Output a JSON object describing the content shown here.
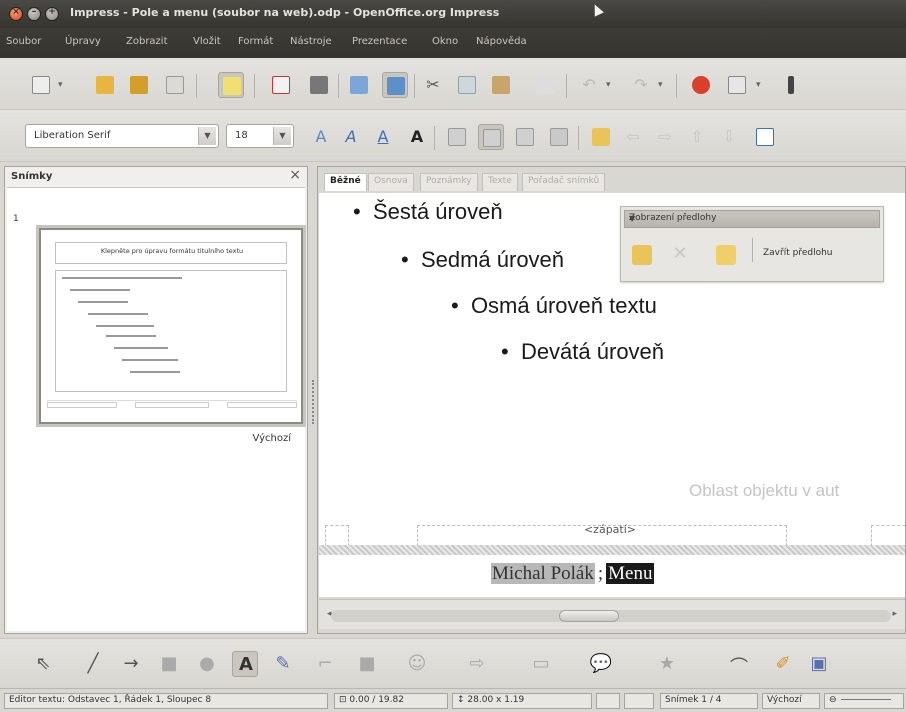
{
  "window": {
    "title": "Impress - Pole a menu (soubor na web).odp - OpenOffice.org Impress"
  },
  "menubar": {
    "items": [
      "Soubor",
      "Úpravy",
      "Zobrazit",
      "Vložit",
      "Formát",
      "Nástroje",
      "Prezentace",
      "Okno",
      "Nápověda"
    ]
  },
  "format_bar": {
    "font_name": "Liberation Serif",
    "font_size": "18"
  },
  "slides_pane": {
    "title": "Snímky",
    "slide_number": "1",
    "thumbnail_title": "Klepněte pro úpravu formátu titulního textu",
    "thumbnail_caption": "Výchozí"
  },
  "tabs": [
    "Běžné",
    "Osnova",
    "Poznámky",
    "Texte",
    "Pořadač snímků"
  ],
  "slide": {
    "outline": [
      "Šestá úroveň",
      "Sedmá úroveň",
      "Osmá úroveň textu",
      "Devátá úroveň"
    ],
    "autolayout_placeholder": "Oblast objektu v aut",
    "footer_field": "<zápatí>",
    "author_name": "Michal Polák",
    "separator": ";",
    "menu_text": "Menu"
  },
  "master_toolbar": {
    "title": "Zobrazení předlohy",
    "close_label": "Zavřít předlohu"
  },
  "statusbar": {
    "edit_status": "Editor textu: Odstavec 1, Řádek 1, Sloupec 8",
    "position": "0.00 / 19.82",
    "size": "28.00 x 1.19",
    "slide_counter": "Snímek 1 / 4",
    "layout_name": "Výchozí"
  },
  "colors": {
    "titlebar": "#3d3c37",
    "close_button": "#d2431a",
    "canvas": "#ffffff",
    "selection": "#1a1a1a"
  }
}
